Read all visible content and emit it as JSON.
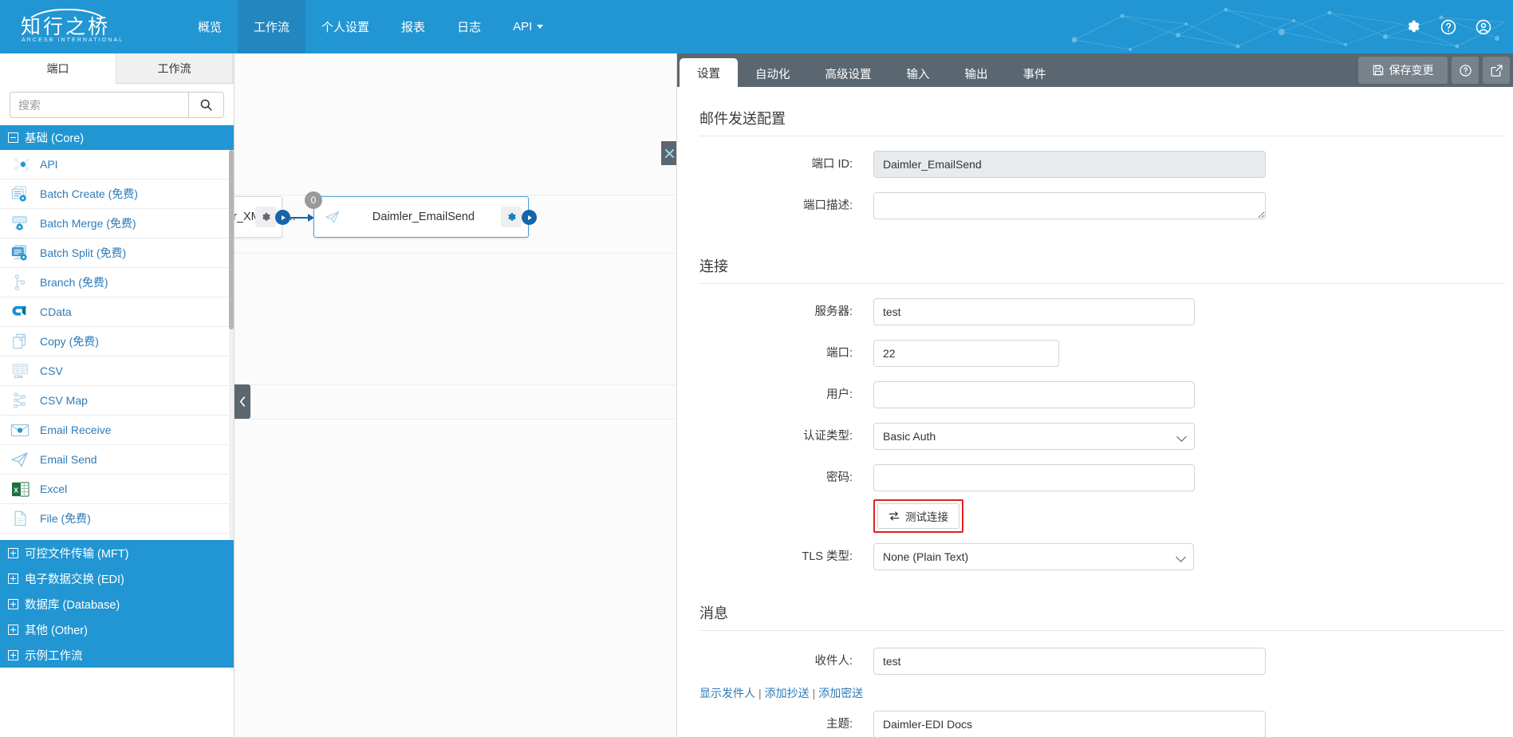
{
  "topnav": {
    "logo_cn": "知行之桥",
    "logo_en": "ARCESB INTERNATIONAL",
    "items": [
      {
        "label": "概览",
        "active": false
      },
      {
        "label": "工作流",
        "active": true
      },
      {
        "label": "个人设置",
        "active": false
      },
      {
        "label": "报表",
        "active": false
      },
      {
        "label": "日志",
        "active": false
      },
      {
        "label": "API",
        "active": false,
        "caret": true
      }
    ],
    "right_icons": [
      "gear-icon",
      "help-circle-icon",
      "user-circle-icon"
    ]
  },
  "sidebar": {
    "tabs": [
      {
        "label": "端口",
        "active": true
      },
      {
        "label": "工作流",
        "active": false
      }
    ],
    "search": {
      "placeholder": "搜索",
      "value": "",
      "icon": "search-icon"
    },
    "core_group": {
      "label": "基础 (Core)",
      "expanded": true,
      "sign": "minus"
    },
    "ports": [
      {
        "label": "API",
        "icon": "api-icon"
      },
      {
        "label": "Batch Create (免费)",
        "icon": "batch-create-icon"
      },
      {
        "label": "Batch Merge (免费)",
        "icon": "batch-merge-icon"
      },
      {
        "label": "Batch Split (免费)",
        "icon": "batch-split-icon"
      },
      {
        "label": "Branch (免费)",
        "icon": "branch-icon"
      },
      {
        "label": "CData",
        "icon": "cdata-icon"
      },
      {
        "label": "Copy (免费)",
        "icon": "copy-icon"
      },
      {
        "label": "CSV",
        "icon": "csv-icon"
      },
      {
        "label": "CSV Map",
        "icon": "csv-map-icon"
      },
      {
        "label": "Email Receive",
        "icon": "email-receive-icon"
      },
      {
        "label": "Email Send",
        "icon": "email-send-icon"
      },
      {
        "label": "Excel",
        "icon": "excel-icon"
      },
      {
        "label": "File (免费)",
        "icon": "file-icon"
      }
    ],
    "groups": [
      {
        "label": "可控文件传输 (MFT)",
        "sign": "plus"
      },
      {
        "label": "电子数据交换 (EDI)",
        "sign": "plus"
      },
      {
        "label": "数据库 (Database)",
        "sign": "plus"
      },
      {
        "label": "其他 (Other)",
        "sign": "plus"
      },
      {
        "label": "示例工作流",
        "sign": "plus"
      }
    ]
  },
  "canvas": {
    "nodes": [
      {
        "label": "Daimler_XMLToE...",
        "selected": false,
        "badge": null
      },
      {
        "label": "Daimler_EmailSend",
        "selected": true,
        "badge": "0",
        "icon": "email-send-icon"
      }
    ],
    "collapse_icon": "chevron-left-icon",
    "close_icon": "close-icon"
  },
  "rpanel": {
    "tabs": [
      {
        "label": "设置",
        "active": true
      },
      {
        "label": "自动化",
        "active": false
      },
      {
        "label": "高级设置",
        "active": false
      },
      {
        "label": "输入",
        "active": false
      },
      {
        "label": "输出",
        "active": false
      },
      {
        "label": "事件",
        "active": false
      }
    ],
    "actions": {
      "save_label": "保存变更",
      "save_icon": "save-icon",
      "help_icon": "help-circle-icon",
      "popout_icon": "external-link-icon"
    },
    "sections": {
      "email_config": {
        "title": "邮件发送配置",
        "port_id": {
          "label": "端口 ID:",
          "value": "Daimler_EmailSend",
          "readonly": true
        },
        "port_desc": {
          "label": "端口描述:",
          "value": "",
          "placeholder": ""
        }
      },
      "connection": {
        "title": "连接",
        "server": {
          "label": "服务器:",
          "value": "test"
        },
        "port": {
          "label": "端口:",
          "value": "22"
        },
        "user": {
          "label": "用户:",
          "value": ""
        },
        "auth_type": {
          "label": "认证类型:",
          "value": "Basic Auth",
          "options": [
            "Basic Auth"
          ]
        },
        "password": {
          "label": "密码:",
          "value": ""
        },
        "test_button": {
          "label": "测试连接",
          "icon": "transfer-icon",
          "highlighted": true
        },
        "tls_type": {
          "label": "TLS 类型:",
          "value": "None (Plain Text)",
          "options": [
            "None (Plain Text)"
          ]
        }
      },
      "message": {
        "title": "消息",
        "to": {
          "label": "收件人:",
          "value": "test"
        },
        "links": [
          {
            "label": "显示发件人"
          },
          {
            "label": "添加抄送"
          },
          {
            "label": "添加密送"
          }
        ],
        "subject": {
          "label": "主题:",
          "value": "Daimler-EDI Docs"
        }
      }
    }
  },
  "colors": {
    "brand": "#2196d3",
    "nav_active": "#2287bf",
    "tabbar": "#5b6770",
    "link": "#2d7bb8",
    "highlight": "#e02020"
  }
}
